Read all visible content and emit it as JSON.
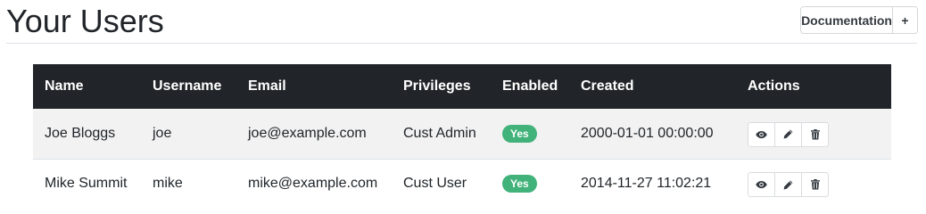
{
  "header": {
    "title": "Your Users",
    "documentation_label": "Documentation",
    "add_label": "+"
  },
  "table": {
    "columns": [
      "Name",
      "Username",
      "Email",
      "Privileges",
      "Enabled",
      "Created",
      "Actions"
    ],
    "rows": [
      {
        "name": "Joe Bloggs",
        "username": "joe",
        "email": "joe@example.com",
        "privileges": "Cust Admin",
        "enabled": "Yes",
        "created": "2000-01-01 00:00:00"
      },
      {
        "name": "Mike Summit",
        "username": "mike",
        "email": "mike@example.com",
        "privileges": "Cust User",
        "enabled": "Yes",
        "created": "2014-11-27 11:02:21"
      }
    ],
    "action_icons": [
      "eye-icon",
      "pencil-icon",
      "trash-icon"
    ]
  },
  "colors": {
    "header_bg": "#212529",
    "badge_green": "#41b27a",
    "row_stripe": "#f2f2f2"
  }
}
